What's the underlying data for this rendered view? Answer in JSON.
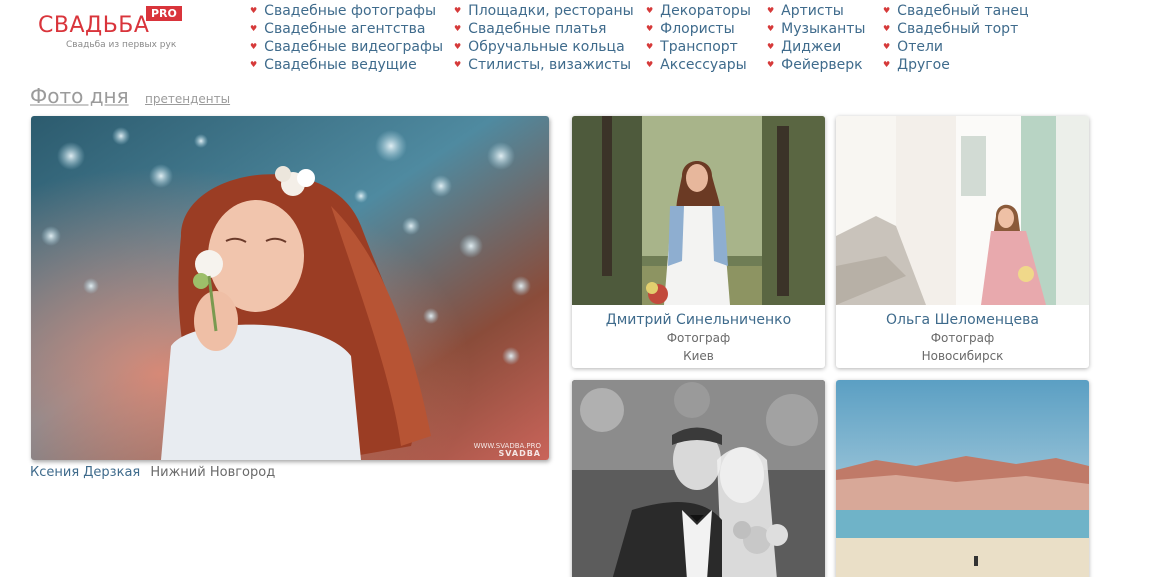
{
  "logo": {
    "text": "СВАДЬБА",
    "badge": "PRO",
    "tagline": "Свадьба из первых рук"
  },
  "nav": {
    "columns": [
      [
        "Свадебные фотографы",
        "Свадебные агентства",
        "Свадебные видеографы",
        "Свадебные ведущие"
      ],
      [
        "Площадки, рестораны",
        "Свадебные платья",
        "Обручальные кольца",
        "Стилисты, визажисты"
      ],
      [
        "Декораторы",
        "Флористы",
        "Транспорт",
        "Аксессуары"
      ],
      [
        "Артисты",
        "Музыканты",
        "Диджеи",
        "Фейерверк"
      ],
      [
        "Свадебный танец",
        "Свадебный торт",
        "Отели",
        "Другое"
      ]
    ]
  },
  "section": {
    "title": "Фото дня",
    "sub_link": "претенденты"
  },
  "featured": {
    "author": "Ксения Дерзкая",
    "city": "Нижний Новгород",
    "watermark_small": "WWW.SVADBA.PRO",
    "watermark_brand": "SVADBA"
  },
  "cards": [
    {
      "name": "Дмитрий Синельниченко",
      "role": "Фотограф",
      "city": "Киев"
    },
    {
      "name": "Ольга Шеломенцева",
      "role": "Фотограф",
      "city": "Новосибирск"
    },
    {
      "name": "",
      "role": "",
      "city": ""
    },
    {
      "name": "",
      "role": "",
      "city": ""
    }
  ],
  "colors": {
    "brand": "#d9343b",
    "link": "#3f6b8c",
    "heart": "#d63a3a"
  }
}
